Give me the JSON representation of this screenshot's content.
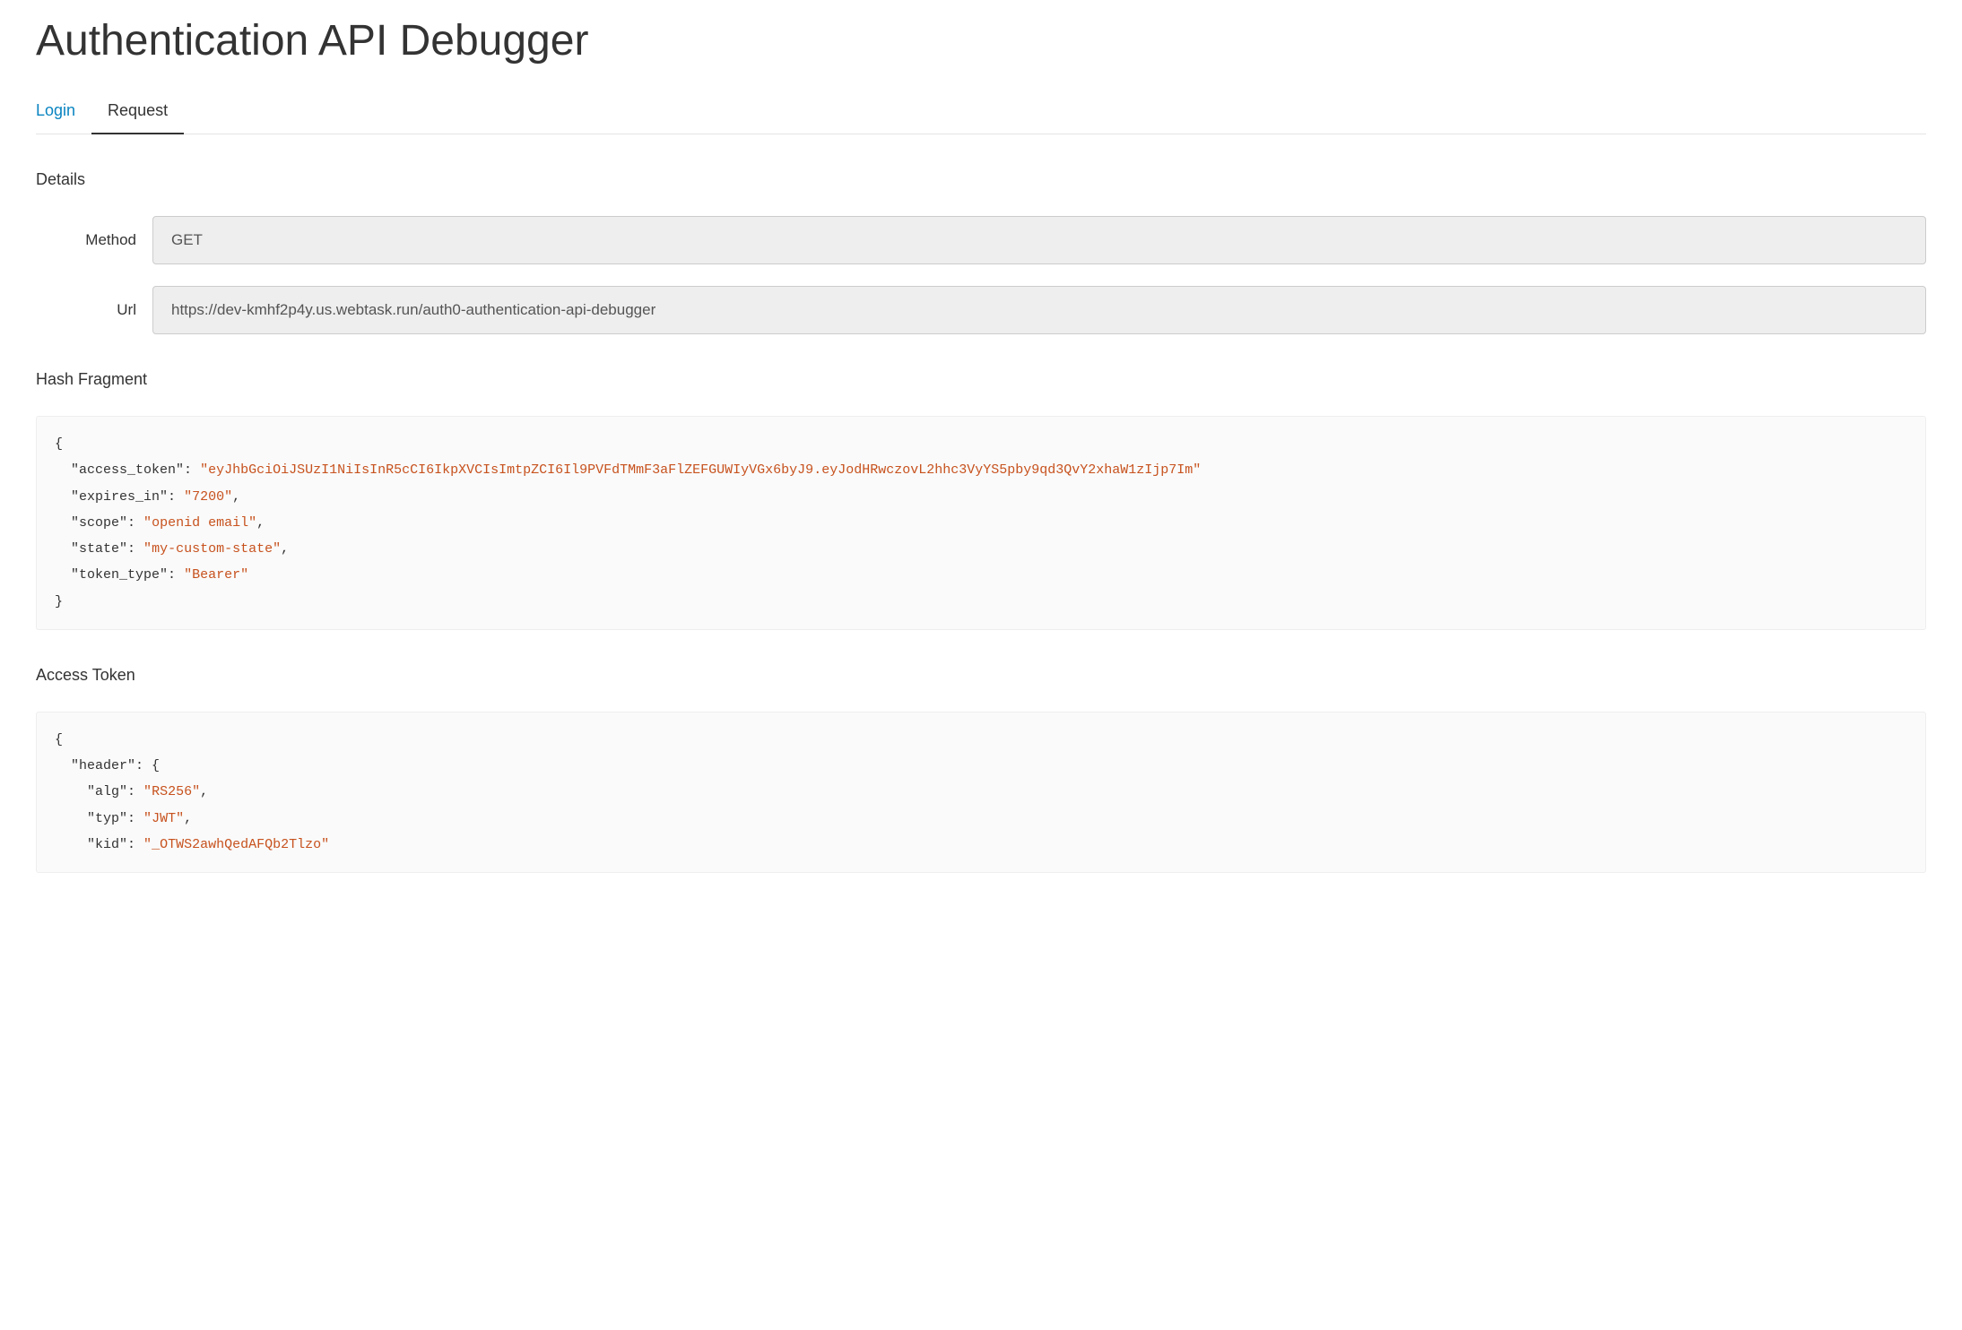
{
  "page_title": "Authentication API Debugger",
  "tabs": {
    "login": "Login",
    "request": "Request"
  },
  "sections": {
    "details": "Details",
    "hash_fragment": "Hash Fragment",
    "access_token": "Access Token"
  },
  "details": {
    "method_label": "Method",
    "method_value": "GET",
    "url_label": "Url",
    "url_value": "https://dev-kmhf2p4y.us.webtask.run/auth0-authentication-api-debugger"
  },
  "hash_fragment": {
    "access_token": "eyJhbGciOiJSUzI1NiIsInR5cCI6IkpXVCIsImtpZCI6Il9PVFdTMmF3aFlZEFGUWIyVGx6byJ9.eyJodHRwczovL2hhc3VyYS5pby9qd3QvY2xhaW1zIjp7Im",
    "expires_in": "7200",
    "scope": "openid email",
    "state": "my-custom-state",
    "token_type": "Bearer"
  },
  "access_token_decoded": {
    "header": {
      "alg": "RS256",
      "typ": "JWT",
      "kid": "_OTWS2awhQedAFQb2Tlzo"
    }
  }
}
